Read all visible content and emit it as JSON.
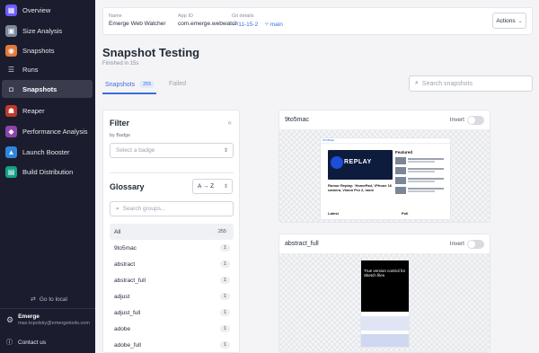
{
  "sidebar": {
    "items": [
      {
        "label": "Overview",
        "icon": "grid-icon",
        "color": "#6d5dfc"
      },
      {
        "label": "Size Analysis",
        "icon": "size-analysis-icon",
        "color": "#7c8a9e"
      },
      {
        "label": "Snapshots",
        "icon": "snapshots-app-icon",
        "color": "#e07a3a"
      },
      {
        "label": "Runs",
        "icon": "list-icon",
        "color": ""
      },
      {
        "label": "Snapshots",
        "icon": "camera-icon",
        "color": ""
      },
      {
        "label": "Reaper",
        "icon": "reaper-icon",
        "color": "#c0392b"
      },
      {
        "label": "Performance Analysis",
        "icon": "performance-icon",
        "color": "#8e44ad"
      },
      {
        "label": "Launch Booster",
        "icon": "launch-booster-icon",
        "color": "#2e86de"
      },
      {
        "label": "Build Distribution",
        "icon": "build-distribution-icon",
        "color": "#16a085"
      }
    ],
    "go_local": "Go to local",
    "user": {
      "name": "Emerge",
      "email": "max.topolsky@emergetools.com"
    },
    "contact": "Contact us"
  },
  "info": {
    "name_label": "Name",
    "name_value": "Emerge Web Watcher",
    "appid_label": "App ID",
    "appid_value": "com.emerge.webwatch",
    "git_label": "Git details",
    "git_commit": "11-15-2",
    "git_branch": "main",
    "actions_label": "Actions"
  },
  "page": {
    "title": "Snapshot Testing",
    "subtitle": "Finished in 15s"
  },
  "tabs": {
    "snapshots_label": "Snapshots",
    "snapshots_count": "255",
    "failed_label": "Failed"
  },
  "search": {
    "placeholder": "Search snapshots"
  },
  "filter": {
    "title": "Filter",
    "by_badge": "by Badge",
    "badge_placeholder": "Select a badge",
    "collapse_glyph": "«"
  },
  "glossary": {
    "title": "Glossary",
    "sort_label": "A → Z",
    "search_placeholder": "Search groups...",
    "groups": [
      {
        "name": "All",
        "count": "255"
      },
      {
        "name": "9to5mac",
        "count": "1"
      },
      {
        "name": "abstract",
        "count": "1"
      },
      {
        "name": "abstract_full",
        "count": "1"
      },
      {
        "name": "adjust",
        "count": "1"
      },
      {
        "name": "adjust_full",
        "count": "1"
      },
      {
        "name": "adobe",
        "count": "1"
      },
      {
        "name": "adobe_full",
        "count": "1"
      }
    ]
  },
  "cards": [
    {
      "name": "9to5mac",
      "invert_label": "Invert"
    },
    {
      "name": "abstract_full",
      "invert_label": "Invert"
    }
  ],
  "preview1": {
    "brand": "9TO5Mac",
    "hero_text": "REPLAY",
    "featured": "Featured",
    "headline": "Rumor Replay: 'HomePad,' iPhone 16 camera, Vision Pro 2, more",
    "latest": "Latest",
    "poll": "Poll"
  },
  "preview2": {
    "headline": "True version control for Sketch files"
  },
  "colors": {
    "sidebar_bg": "#1b1d2e",
    "accent": "#3b6fd9"
  }
}
